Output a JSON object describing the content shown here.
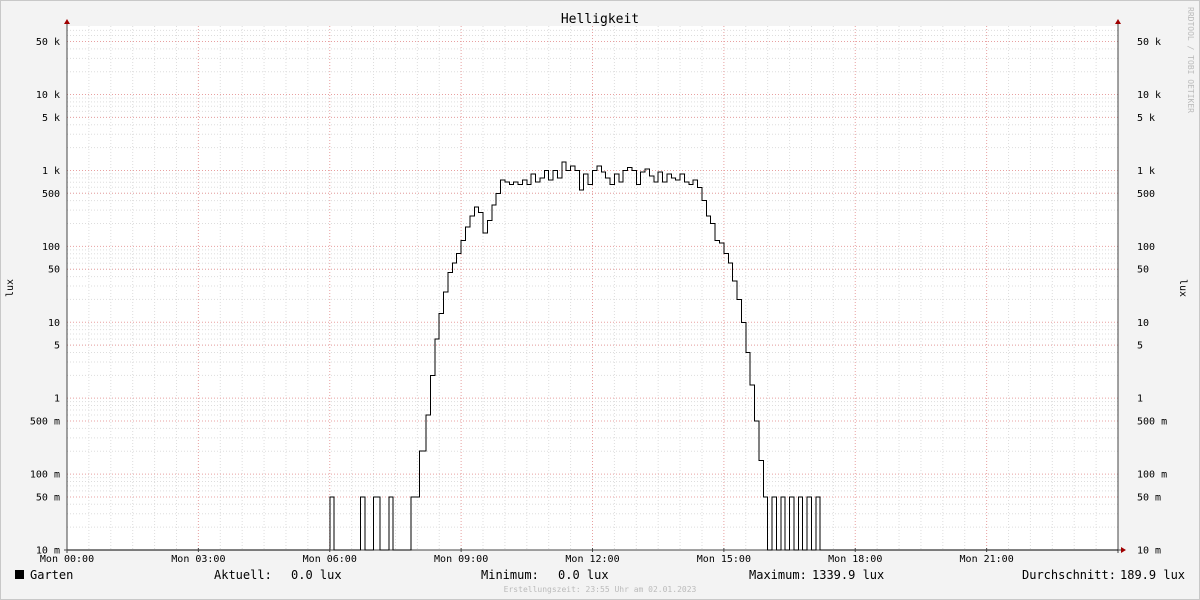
{
  "chart_data": {
    "type": "line",
    "title": "Helligkeit",
    "ylabel": "lux",
    "yscale": "log",
    "ylim": [
      0.01,
      80000
    ],
    "xlim": [
      0,
      24
    ],
    "x_ticks": [
      {
        "value": 0,
        "label": "Mon 00:00"
      },
      {
        "value": 3,
        "label": "Mon 03:00"
      },
      {
        "value": 6,
        "label": "Mon 06:00"
      },
      {
        "value": 9,
        "label": "Mon 09:00"
      },
      {
        "value": 12,
        "label": "Mon 12:00"
      },
      {
        "value": 15,
        "label": "Mon 15:00"
      },
      {
        "value": 18,
        "label": "Mon 18:00"
      },
      {
        "value": 21,
        "label": "Mon 21:00"
      }
    ],
    "y_ticks": [
      {
        "value": 50000,
        "label": "50 k"
      },
      {
        "value": 10000,
        "label": "10 k"
      },
      {
        "value": 5000,
        "label": "5 k"
      },
      {
        "value": 1000,
        "label": "1 k"
      },
      {
        "value": 500,
        "label": "500"
      },
      {
        "value": 100,
        "label": "100"
      },
      {
        "value": 50,
        "label": "50"
      },
      {
        "value": 10,
        "label": "10"
      },
      {
        "value": 5,
        "label": "5"
      },
      {
        "value": 1,
        "label": "1"
      },
      {
        "value": 0.5,
        "label": "500 m"
      },
      {
        "value": 0.1,
        "label": "100 m"
      },
      {
        "value": 0.05,
        "label": "50 m"
      },
      {
        "value": 0.01,
        "label": "10 m"
      }
    ],
    "grid": true,
    "series": [
      {
        "name": "Garten",
        "color": "#000000",
        "x": [
          0,
          6.0,
          6.1,
          6.7,
          6.8,
          7.0,
          7.15,
          7.35,
          7.45,
          7.85,
          8.05,
          8.2,
          8.3,
          8.4,
          8.5,
          8.6,
          8.7,
          8.8,
          8.9,
          9.0,
          9.1,
          9.2,
          9.3,
          9.4,
          9.5,
          9.6,
          9.7,
          9.8,
          9.9,
          10.0,
          10.1,
          10.2,
          10.3,
          10.4,
          10.5,
          10.6,
          10.7,
          10.8,
          10.9,
          11.0,
          11.1,
          11.2,
          11.3,
          11.4,
          11.5,
          11.6,
          11.7,
          11.8,
          11.9,
          12.0,
          12.1,
          12.2,
          12.3,
          12.4,
          12.5,
          12.6,
          12.7,
          12.8,
          12.9,
          13.0,
          13.1,
          13.2,
          13.3,
          13.4,
          13.5,
          13.6,
          13.7,
          13.8,
          13.9,
          14.0,
          14.1,
          14.2,
          14.3,
          14.4,
          14.5,
          14.6,
          14.7,
          14.8,
          14.9,
          15.0,
          15.1,
          15.2,
          15.3,
          15.4,
          15.5,
          15.6,
          15.7,
          15.8,
          15.9,
          16.0,
          16.1,
          16.2,
          16.3,
          16.4,
          16.5,
          16.6,
          16.7,
          16.8,
          16.9,
          17.0,
          17.1,
          17.2,
          17.3,
          17.4,
          17.5,
          17.7,
          17.95,
          18.35,
          19.0,
          19.5,
          20.15,
          20.3,
          20.5,
          22.1,
          22.15,
          22.3,
          24
        ],
        "y": [
          0.01,
          0.05,
          0.01,
          0.05,
          0.01,
          0.05,
          0.01,
          0.05,
          0.01,
          0.05,
          0.2,
          0.6,
          2,
          6,
          13,
          25,
          45,
          60,
          80,
          120,
          180,
          250,
          330,
          280,
          150,
          220,
          350,
          500,
          750,
          700,
          650,
          700,
          650,
          750,
          650,
          900,
          700,
          800,
          1000,
          750,
          1000,
          800,
          1300,
          1000,
          1150,
          1000,
          550,
          900,
          650,
          1000,
          1150,
          950,
          800,
          650,
          900,
          700,
          1000,
          1100,
          1000,
          650,
          950,
          1050,
          850,
          700,
          950,
          700,
          900,
          800,
          750,
          900,
          700,
          650,
          750,
          600,
          400,
          250,
          200,
          120,
          110,
          80,
          60,
          35,
          20,
          10,
          4,
          1.5,
          0.5,
          0.15,
          0.05,
          0.01,
          0.05,
          0.01,
          0.05,
          0.01,
          0.05,
          0.01,
          0.05,
          0.01,
          0.05,
          0.01,
          0.05,
          0.01,
          0.01,
          0.01,
          0.01,
          0.01,
          0.01,
          0.01,
          0.01,
          0.01,
          0.01,
          0.01,
          0.01,
          0.01,
          0.01,
          0.01,
          0.01
        ]
      }
    ]
  },
  "legend": {
    "series_name": "Garten",
    "current_label": "Aktuell:",
    "current_value": "0.0 lux",
    "min_label": "Minimum:",
    "min_value": "0.0 lux",
    "max_label": "Maximum:",
    "max_value": "1339.9 lux",
    "avg_label": "Durchschnitt:",
    "avg_value": "189.9 lux"
  },
  "footer": "Erstellungszeit: 23:55 Uhr am 02.01.2023",
  "watermark": "RRDTOOL / TOBI OETIKER",
  "colors": {
    "background": "#f3f3f3",
    "canvas": "#ffffff",
    "major_grid": "#e8a0a0",
    "minor_grid": "#dddddd",
    "axis": "#444444",
    "arrow": "#a00000",
    "line": "#000000"
  }
}
